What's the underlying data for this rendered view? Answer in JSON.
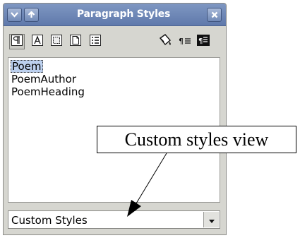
{
  "window": {
    "title": "Paragraph Styles"
  },
  "titlebar_buttons": [
    {
      "name": "menu-button",
      "icon": "chevron-down-icon"
    },
    {
      "name": "roll-up-button",
      "icon": "chevron-up-icon"
    },
    {
      "name": "close-button",
      "icon": "close-icon"
    }
  ],
  "toolbar": {
    "items": [
      {
        "name": "paragraph-styles",
        "icon": "paragraph-styles-icon",
        "active": true
      },
      {
        "name": "character-styles",
        "icon": "character-styles-icon"
      },
      {
        "name": "frame-styles",
        "icon": "frame-styles-icon"
      },
      {
        "name": "page-styles",
        "icon": "page-styles-icon"
      },
      {
        "name": "list-styles",
        "icon": "list-styles-icon"
      },
      {
        "name": "fill-format-mode",
        "icon": "fill-format-icon"
      },
      {
        "name": "new-style-from-selection",
        "icon": "new-style-icon"
      },
      {
        "name": "update-style",
        "icon": "update-style-icon"
      }
    ]
  },
  "styles_list": {
    "items": [
      {
        "label": "Poem",
        "selected": true
      },
      {
        "label": "PoemAuthor"
      },
      {
        "label": "PoemHeading"
      }
    ]
  },
  "filter": {
    "selected": "Custom Styles"
  },
  "callout": {
    "text": "Custom styles view"
  },
  "colors": {
    "titlebar": "#6d86b8",
    "panel": "#d6d6d0",
    "selection": "#bcd0ee"
  }
}
